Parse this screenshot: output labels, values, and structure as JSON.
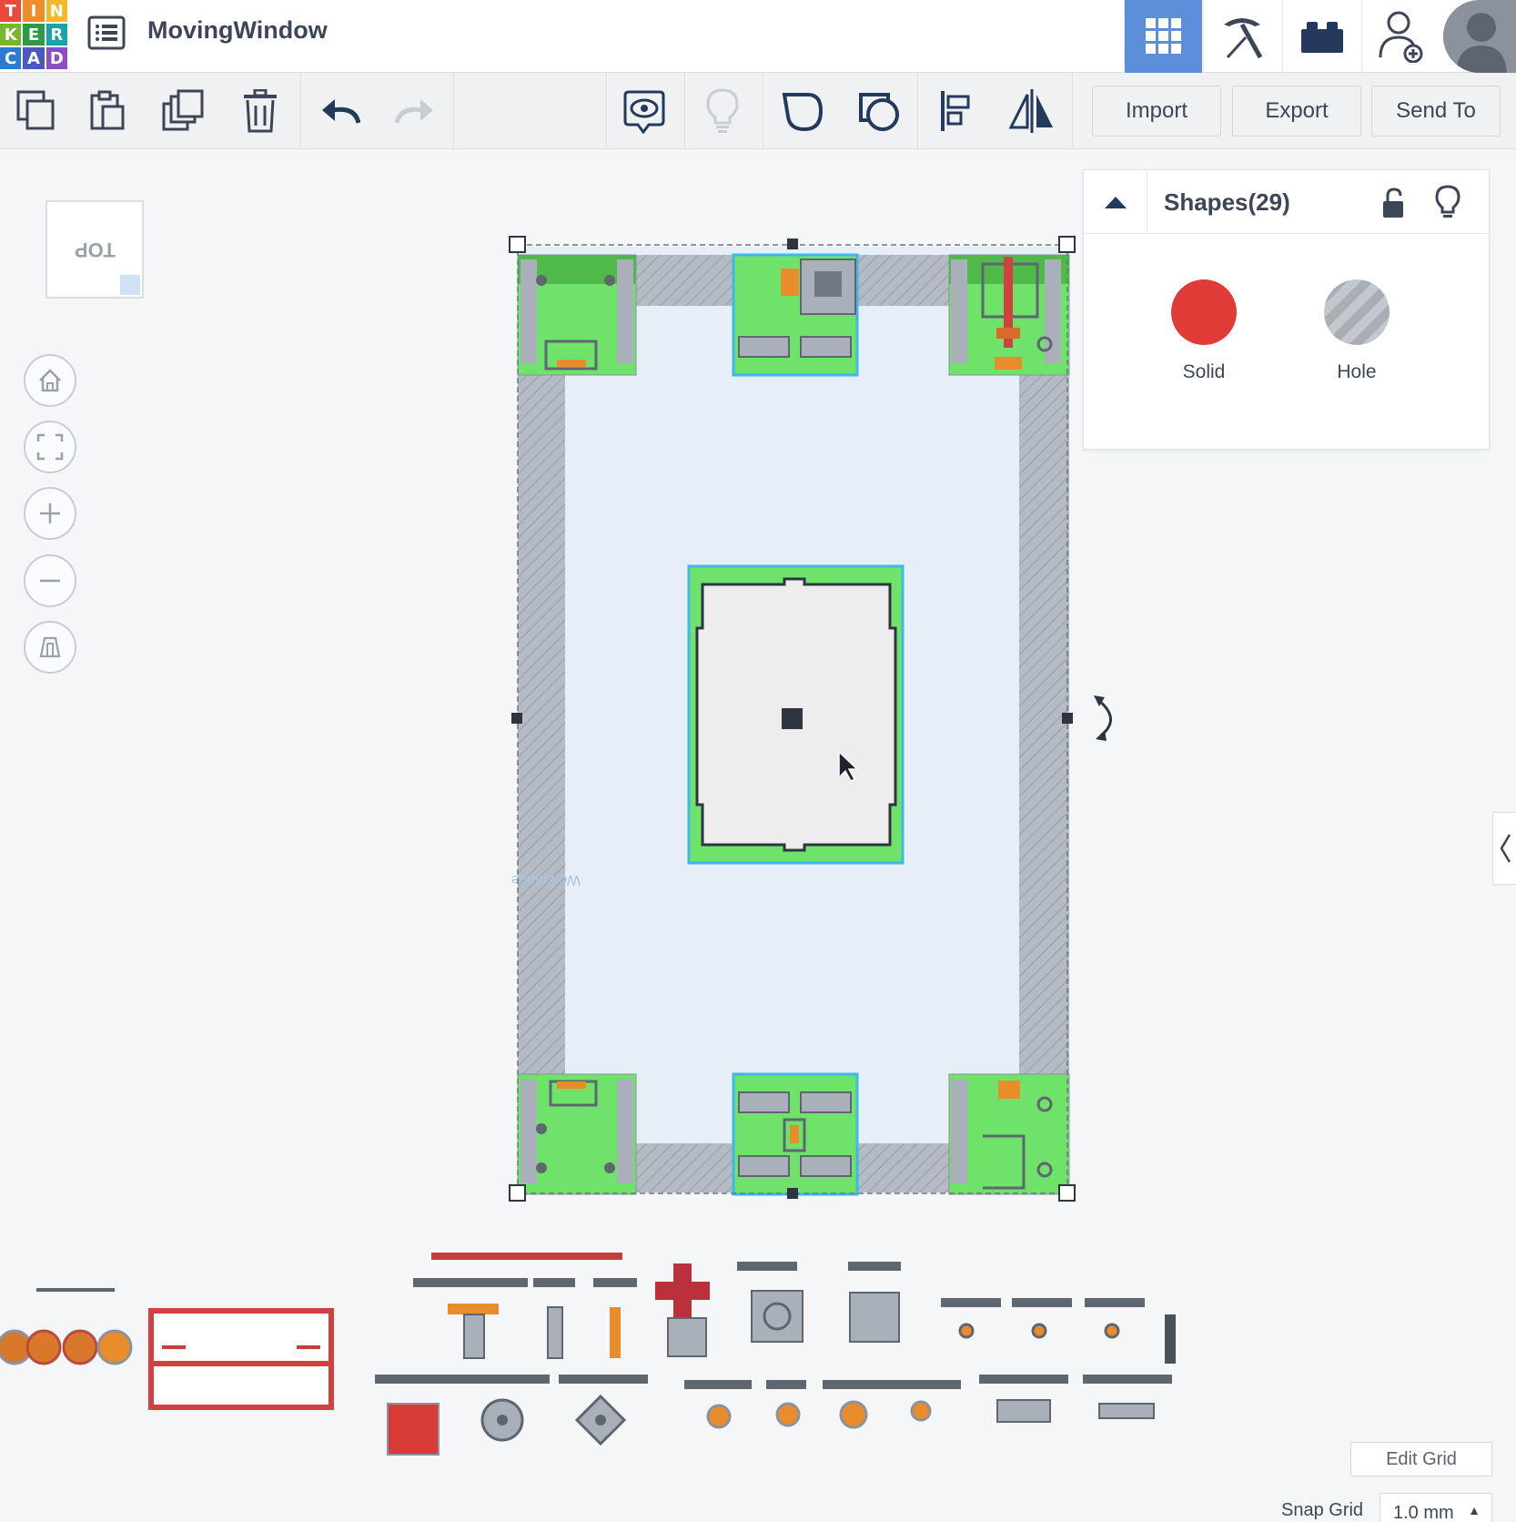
{
  "app": {
    "logo_letters": [
      "T",
      "I",
      "N",
      "K",
      "E",
      "R",
      "C",
      "A",
      "D"
    ],
    "logo_colors": [
      "#e84a3b",
      "#f08c2a",
      "#f1b92b",
      "#76b82a",
      "#2f9a46",
      "#18a3a9",
      "#2d7ad3",
      "#4b57c2",
      "#8b4ec3"
    ],
    "design_title": "MovingWindow"
  },
  "header": {
    "buttons": [
      {
        "name": "3d-design-grid-icon",
        "active": true
      },
      {
        "name": "codeblocks-pickaxe-icon",
        "active": false
      },
      {
        "name": "bricks-icon",
        "active": false
      },
      {
        "name": "invite-user-icon",
        "active": false
      }
    ]
  },
  "toolbar": {
    "import_label": "Import",
    "export_label": "Export",
    "send_to_label": "Send To"
  },
  "viewcube": {
    "face_label": "TOP"
  },
  "workplane": {
    "label": "Workplane"
  },
  "shapes_panel": {
    "title": "Shapes(29)",
    "solid_label": "Solid",
    "hole_label": "Hole",
    "solid_color": "#e03b36"
  },
  "bottom": {
    "edit_grid_label": "Edit Grid",
    "snap_grid_label": "Snap Grid",
    "snap_grid_value": "1.0 mm"
  },
  "colors": {
    "selection_outline": "#3fb7e8",
    "part_green": "#6fe26a",
    "frame_gray": "#a9b0ba",
    "accent_blue": "#5b8fd9"
  }
}
